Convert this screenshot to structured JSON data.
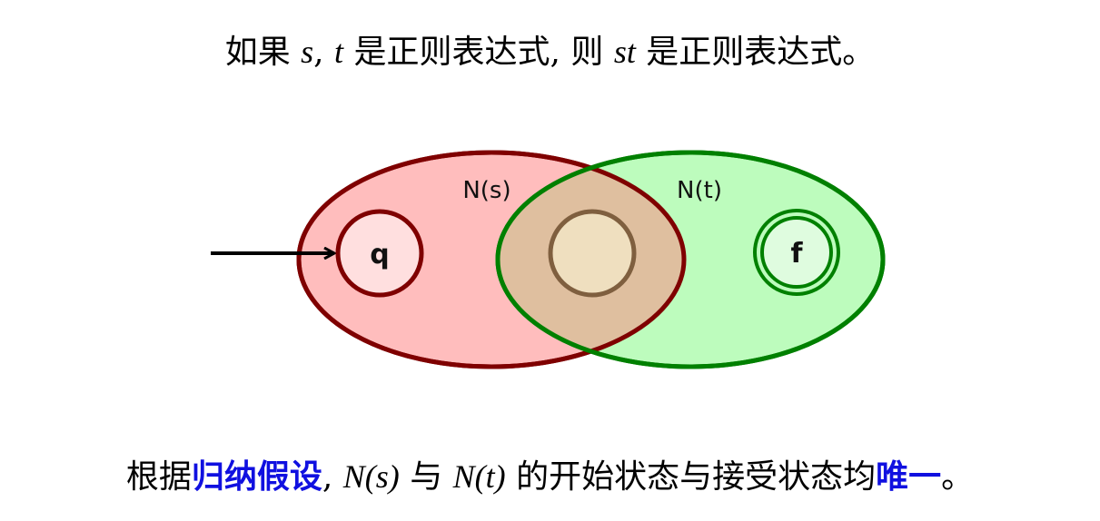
{
  "statement": {
    "p1": "如果 ",
    "s": "s",
    "comma": ", ",
    "t": "t",
    "p2": " 是正则表达式, 则 ",
    "st": "st",
    "p3": " 是正则表达式。"
  },
  "diagram": {
    "label_ns": "N(s)",
    "label_nt": "N(t)",
    "start_state": "q",
    "final_state": "f",
    "colors": {
      "ns_fill": "#ffbdbd",
      "ns_stroke": "#7f0000",
      "nt_fill": "#bdfcbd",
      "nt_stroke": "#008000",
      "overlap_fill": "#dfbf9f",
      "middle_state_fill": "#efdfbf",
      "middle_state_stroke": "#7f5f3f",
      "start_state_fill": "#ffdfdf",
      "final_state_fill": "#dffcdf"
    }
  },
  "conclusion": {
    "p1": "根据",
    "hl1": "归纳假设",
    "p2": ", ",
    "ns": "N(s)",
    "p3": " 与 ",
    "nt": "N(t)",
    "p4": " 的开始状态与接受状态均",
    "hl2": "唯一",
    "p5": "。"
  }
}
